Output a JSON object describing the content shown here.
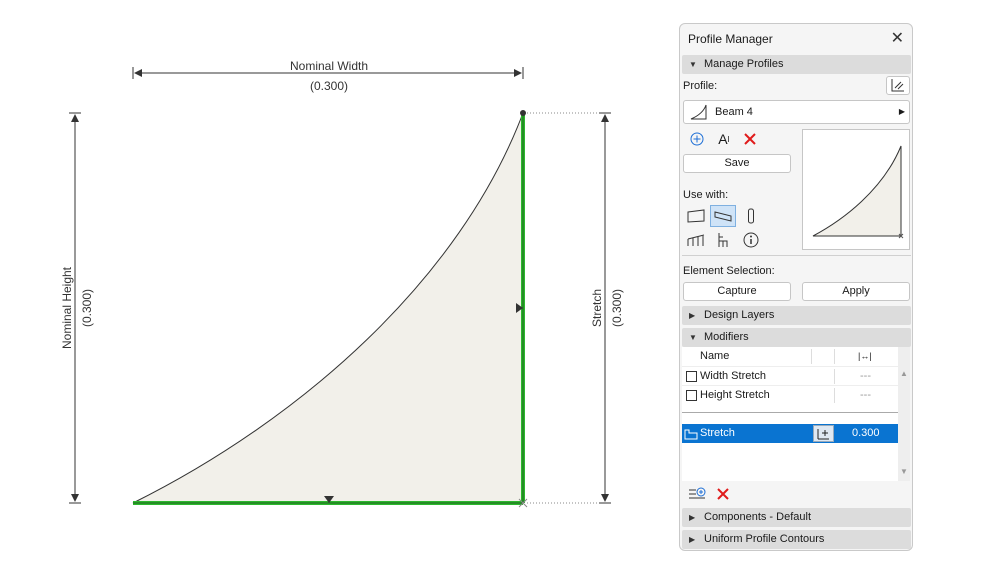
{
  "drawing": {
    "nominal_width_label": "Nominal Width",
    "nominal_width_value": "(0.300)",
    "nominal_height_label": "Nominal Height",
    "nominal_height_value": "(0.300)",
    "stretch_label": "Stretch",
    "stretch_value": "(0.300)"
  },
  "panel": {
    "title": "Profile Manager",
    "manage_profiles": "Manage Profiles",
    "profile_label": "Profile:",
    "profile_name": "Beam 4",
    "save": "Save",
    "use_with": "Use with:",
    "element_selection": "Element Selection:",
    "capture": "Capture",
    "apply": "Apply",
    "design_layers": "Design Layers",
    "modifiers": "Modifiers",
    "name_header": "Name",
    "rows": [
      {
        "name": "Width Stretch",
        "value": "---"
      },
      {
        "name": "Height Stretch",
        "value": "---"
      }
    ],
    "selected_row": {
      "name": "Stretch",
      "value": "0.300"
    },
    "components": "Components - Default",
    "uniform_contours": "Uniform Profile Contours"
  },
  "colors": {
    "accent_green": "#2db82d",
    "selection_blue": "#0a74d1",
    "fill": "#f2f0ea",
    "delete_red": "#e01b1b"
  }
}
